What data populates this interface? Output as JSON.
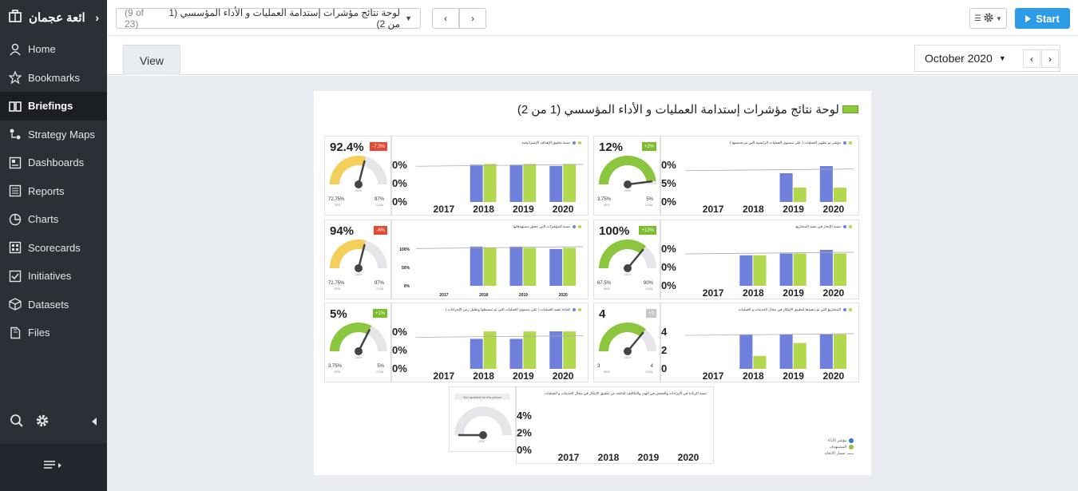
{
  "sidebar": {
    "org": "ائعة عجمان",
    "items": [
      {
        "label": "Home",
        "icon": "user-icon"
      },
      {
        "label": "Bookmarks",
        "icon": "star-icon"
      },
      {
        "label": "Briefings",
        "icon": "book-icon",
        "active": true
      },
      {
        "label": "Strategy Maps",
        "icon": "strategy-map-icon"
      },
      {
        "label": "Dashboards",
        "icon": "dashboard-icon"
      },
      {
        "label": "Reports",
        "icon": "report-icon"
      },
      {
        "label": "Charts",
        "icon": "pie-chart-icon"
      },
      {
        "label": "Scorecards",
        "icon": "scorecard-icon"
      },
      {
        "label": "Initiatives",
        "icon": "checkbox-icon"
      },
      {
        "label": "Datasets",
        "icon": "cube-icon"
      },
      {
        "label": "Files",
        "icon": "file-icon"
      }
    ]
  },
  "topbar": {
    "briefing_title": "لوحة نتائج مؤشرات إستدامة العمليات و الأداء المؤسسي (1 من 2)",
    "briefing_count": "(9 of 23)",
    "start_label": "Start"
  },
  "tabs": {
    "view_label": "View"
  },
  "period": {
    "label": "October 2020"
  },
  "sheet": {
    "title": "لوحة نتائج مؤشرات إستدامة العمليات و الأداء المؤسسي (1 من 2)"
  },
  "colors": {
    "actual": "#6f7fdc",
    "target": "#b3d84e",
    "gauge_yellow": "#f3cf5a",
    "gauge_green": "#8cc63f",
    "badge_red": "#e34a33",
    "badge_green": "#7cbb2c",
    "badge_gray": "#c7c7c7",
    "accent": "#2e9be6"
  },
  "kpis": [
    {
      "value": "92.4%",
      "badge": "-7.3%",
      "badge_type": "red",
      "fill": "yellow",
      "low": "72.75%",
      "low_sub": "RED",
      "high": "97%",
      "high_sub": "GOAL",
      "year": "2020",
      "chart_title": "نسبة تحقيق الإهداف الإستراتيجية",
      "ticks": [
        "0%",
        "0%",
        "0%"
      ],
      "chart_data": {
        "type": "bar",
        "categories": [
          "2017",
          "2018",
          "2019",
          "2020"
        ],
        "series": [
          {
            "values": [
              null,
              0.95,
              0.95,
              0.92
            ]
          },
          {
            "values": [
              null,
              0.97,
              0.97,
              0.97
            ]
          }
        ],
        "ylim": [
          0,
          1.1
        ]
      }
    },
    {
      "value": "12%",
      "badge": "+2%",
      "badge_type": "green",
      "fill": "green",
      "low": "3.75%",
      "low_sub": "RED",
      "high": "5%",
      "high_sub": "GOAL",
      "year": "2020",
      "chart_title": "مؤشر تم تطوير العمليات ( على مستوى العمليات الرئيسية التي تم تحسينها )",
      "ticks": [
        "0%",
        "5%",
        "0%"
      ],
      "chart_data": {
        "type": "bar",
        "categories": [
          "2017",
          "2018",
          "2019",
          "2020"
        ],
        "series": [
          {
            "values": [
              null,
              null,
              0.8,
              1.0
            ]
          },
          {
            "values": [
              null,
              null,
              0.4,
              0.4
            ]
          }
        ],
        "ylim": [
          0,
          1.2
        ]
      }
    },
    {
      "value": "94%",
      "badge": "-6%",
      "badge_type": "red",
      "fill": "yellow",
      "low": "72.75%",
      "low_sub": "RED",
      "high": "97%",
      "high_sub": "GOAL",
      "year": "2020",
      "chart_title": "نسبة المؤشرات التي تحقق مستهدفاتها",
      "ticks": [
        "100%",
        "50%",
        "0%"
      ],
      "chart_data": {
        "type": "bar",
        "categories": [
          "2017",
          "2018",
          "2019",
          "2020"
        ],
        "series": [
          {
            "values": [
              null,
              100,
              100,
              94
            ]
          },
          {
            "values": [
              null,
              97,
              97,
              97
            ]
          }
        ],
        "ylim": [
          0,
          110
        ]
      }
    },
    {
      "value": "100%",
      "badge": "+13%",
      "badge_type": "green",
      "fill": "green",
      "low": "67.5%",
      "low_sub": "RED",
      "high": "90%",
      "high_sub": "GOAL",
      "year": "2020",
      "chart_title": "نسبة الإنجاز في تنفيذ المشاريع",
      "ticks": [
        "0%",
        "0%",
        "0%"
      ],
      "chart_data": {
        "type": "bar",
        "categories": [
          "2017",
          "2018",
          "2019",
          "2020"
        ],
        "series": [
          {
            "values": [
              null,
              0.85,
              0.9,
              1.0
            ]
          },
          {
            "values": [
              null,
              0.85,
              0.9,
              0.9
            ]
          }
        ],
        "ylim": [
          0,
          1.2
        ]
      }
    },
    {
      "value": "5%",
      "badge": "+1%",
      "badge_type": "green",
      "fill": "green",
      "low": "3.75%",
      "low_sub": "RED",
      "high": "5%",
      "high_sub": "GOAL",
      "year": "2020",
      "chart_title": "كفاءة تنفيذ العمليات ( على مستوى العمليات التي تم تبسيطها وتقليل زمن الإجراءات )",
      "ticks": [
        "0%",
        "0%",
        "0%"
      ],
      "chart_data": {
        "type": "bar",
        "categories": [
          "2017",
          "2018",
          "2019",
          "2020"
        ],
        "series": [
          {
            "values": [
              null,
              0.8,
              0.8,
              1.0
            ]
          },
          {
            "values": [
              null,
              1.0,
              1.0,
              1.0
            ]
          }
        ],
        "ylim": [
          0,
          1.15
        ]
      }
    },
    {
      "value": "4",
      "badge": "+0",
      "badge_type": "gray",
      "fill": "green",
      "low": "3",
      "low_sub": "RED",
      "high": "4",
      "high_sub": "GOAL",
      "year": "2020",
      "chart_title": "المشاريع التي تم تنفيذها لتطبيق الإبتكار في مجال الخدمات و العمليات",
      "ticks": [
        "4",
        "2",
        "0"
      ],
      "chart_data": {
        "type": "bar",
        "categories": [
          "2017",
          "2018",
          "2019",
          "2020"
        ],
        "series": [
          {
            "values": [
              null,
              4,
              4,
              4
            ]
          },
          {
            "values": [
              null,
              1.5,
              3,
              4
            ]
          }
        ],
        "ylim": [
          0,
          5
        ]
      }
    }
  ],
  "kpi7": {
    "status": "Not updated for this period",
    "year": "2020",
    "chart_title": "نسبة الزيادة في الإيرادات والخفض في الهدر والتكاليف الناتجة عن تطبيق الإبتكار في مجال الخدمات و العمليات",
    "ticks": [
      "4%",
      "2%",
      "0%"
    ],
    "chart_data": {
      "type": "bar",
      "categories": [
        "2017",
        "2018",
        "2019",
        "2020"
      ],
      "series": [],
      "ylim": [
        0,
        4
      ]
    }
  },
  "legend": [
    {
      "label": "مؤشر الأداء",
      "color": "#2e77d0"
    },
    {
      "label": "المستهدف",
      "color": "#8cc63f"
    },
    {
      "label": "مسار الاتجاه",
      "color": "#999"
    }
  ]
}
